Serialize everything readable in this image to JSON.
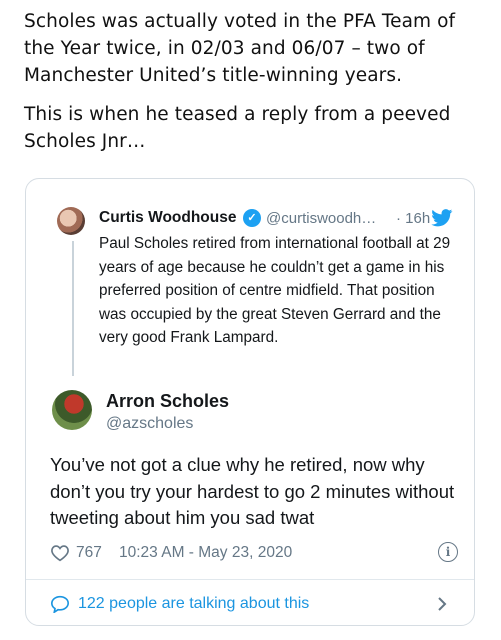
{
  "article": {
    "paragraph1": "Scholes was actually voted in the PFA Team of the Year twice, in 02/03 and 06/07 – two of Manchester United’s title-winning years.",
    "paragraph2": "This is when he teased a reply from a peeved Scholes Jnr…"
  },
  "embed": {
    "quoted": {
      "name": "Curtis Woodhouse",
      "handle": "@curtiswoodh…",
      "time": "· 16h",
      "text": "Paul Scholes retired from international football at 29 years of age because he couldn’t get a game in his preferred position of centre midfield. That position was occupied by the great Steven Gerrard and the very good Frank Lampard."
    },
    "reply": {
      "name": "Arron Scholes",
      "handle": "@azscholes",
      "text": "You’ve not got a clue why he retired, now why don’t you try your hardest to go 2 minutes without tweeting about him you sad twat"
    },
    "likes": "767",
    "timestamp": "10:23 AM - May 23, 2020",
    "conversation": "122 people are talking about this"
  },
  "colors": {
    "twitter_blue": "#1da1f2",
    "link_blue": "#1b95e0",
    "muted": "#657786"
  }
}
